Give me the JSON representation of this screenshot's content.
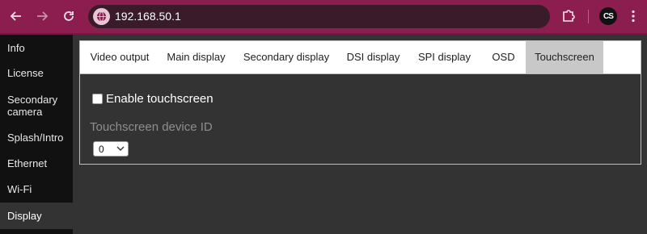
{
  "browser": {
    "url": "192.168.50.1",
    "profile_initials": "CS"
  },
  "icons": {
    "back": "arrow-left-icon",
    "forward": "arrow-right-icon",
    "reload": "reload-icon",
    "site": "globe-icon",
    "extensions": "puzzle-icon",
    "menu": "kebab-menu-icon",
    "select_arrow": "chevron-down-icon"
  },
  "colors": {
    "chrome_accent": "#8b1e4f",
    "omnibox": "#3a1b29",
    "sidebar": "#111111",
    "page_background": "#333333",
    "active_tab": "#c8c8c8"
  },
  "sidebar": {
    "items": [
      {
        "label": "Info"
      },
      {
        "label": "License"
      },
      {
        "label": "Secondary camera"
      },
      {
        "label": "Splash/Intro"
      },
      {
        "label": "Ethernet"
      },
      {
        "label": "Wi-Fi"
      },
      {
        "label": "Display",
        "active": true
      }
    ]
  },
  "tabs": [
    {
      "label": "Video output"
    },
    {
      "label": "Main display"
    },
    {
      "label": "Secondary display"
    },
    {
      "label": "DSI display"
    },
    {
      "label": "SPI display"
    },
    {
      "label": "OSD"
    },
    {
      "label": "Touchscreen",
      "active": true
    }
  ],
  "touchscreen": {
    "enable_label": "Enable touchscreen",
    "enable_checked": false,
    "device_id_label": "Touchscreen device ID",
    "device_id_value": "0"
  }
}
